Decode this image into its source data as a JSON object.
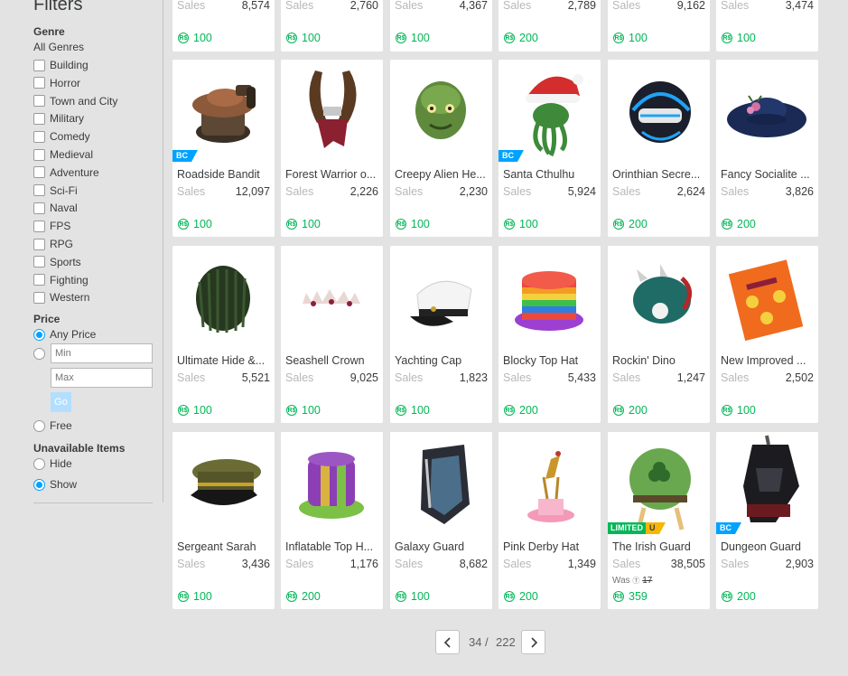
{
  "sidebar": {
    "title": "Filters",
    "genre_title": "Genre",
    "genre_all": "All Genres",
    "genres": [
      "Building",
      "Horror",
      "Town and City",
      "Military",
      "Comedy",
      "Medieval",
      "Adventure",
      "Sci-Fi",
      "Naval",
      "FPS",
      "RPG",
      "Sports",
      "Fighting",
      "Western"
    ],
    "price_title": "Price",
    "any_price": "Any Price",
    "min_placeholder": "Min",
    "max_placeholder": "Max",
    "go_label": "Go",
    "free_label": "Free",
    "unavailable_title": "Unavailable Items",
    "hide_label": "Hide",
    "show_label": "Show"
  },
  "top_row": [
    {
      "sales_label": "Sales",
      "sales": "8,574",
      "price": "100"
    },
    {
      "sales_label": "Sales",
      "sales": "2,760",
      "price": "100"
    },
    {
      "sales_label": "Sales",
      "sales": "4,367",
      "price": "100"
    },
    {
      "sales_label": "Sales",
      "sales": "2,789",
      "price": "200"
    },
    {
      "sales_label": "Sales",
      "sales": "9,162",
      "price": "100"
    },
    {
      "sales_label": "Sales",
      "sales": "3,474",
      "price": "100"
    }
  ],
  "items": [
    {
      "name": "Roadside Bandit",
      "sales_label": "Sales",
      "sales": "12,097",
      "price": "100",
      "badge": "BC",
      "icon": "roadside-bandit-hat-icon"
    },
    {
      "name": "Forest Warrior o...",
      "sales_label": "Sales",
      "sales": "2,226",
      "price": "100",
      "icon": "forest-warrior-horns-icon"
    },
    {
      "name": "Creepy Alien He...",
      "sales_label": "Sales",
      "sales": "2,230",
      "price": "100",
      "icon": "alien-head-icon"
    },
    {
      "name": "Santa Cthulhu",
      "sales_label": "Sales",
      "sales": "5,924",
      "price": "100",
      "badge": "BC",
      "icon": "santa-cthulhu-icon"
    },
    {
      "name": "Orinthian Secre...",
      "sales_label": "Sales",
      "sales": "2,624",
      "price": "200",
      "icon": "orinthian-helmet-icon"
    },
    {
      "name": "Fancy Socialite ...",
      "sales_label": "Sales",
      "sales": "3,826",
      "price": "200",
      "icon": "fancy-hat-icon"
    },
    {
      "name": "Ultimate Hide &...",
      "sales_label": "Sales",
      "sales": "5,521",
      "price": "100",
      "icon": "leafy-hair-icon"
    },
    {
      "name": "Seashell Crown",
      "sales_label": "Sales",
      "sales": "9,025",
      "price": "100",
      "icon": "seashell-crown-icon"
    },
    {
      "name": "Yachting Cap",
      "sales_label": "Sales",
      "sales": "1,823",
      "price": "100",
      "icon": "yachting-cap-icon"
    },
    {
      "name": "Blocky Top Hat",
      "sales_label": "Sales",
      "sales": "5,433",
      "price": "200",
      "icon": "rainbow-top-hat-icon"
    },
    {
      "name": "Rockin' Dino",
      "sales_label": "Sales",
      "sales": "1,247",
      "price": "200",
      "icon": "dino-helmet-icon"
    },
    {
      "name": "New Improved ...",
      "sales_label": "Sales",
      "sales": "2,502",
      "price": "100",
      "icon": "joke-book-icon"
    },
    {
      "name": "Sergeant Sarah",
      "sales_label": "Sales",
      "sales": "3,436",
      "price": "100",
      "icon": "sergeant-cap-icon"
    },
    {
      "name": "Inflatable Top H...",
      "sales_label": "Sales",
      "sales": "1,176",
      "price": "200",
      "icon": "inflatable-top-hat-icon"
    },
    {
      "name": "Galaxy Guard",
      "sales_label": "Sales",
      "sales": "8,682",
      "price": "100",
      "icon": "galaxy-guard-helmet-icon"
    },
    {
      "name": "Pink Derby Hat",
      "sales_label": "Sales",
      "sales": "1,349",
      "price": "200",
      "icon": "pink-derby-hat-icon"
    },
    {
      "name": "The Irish Guard",
      "sales_label": "Sales",
      "sales": "38,505",
      "price": "359",
      "badge": "LIMITED",
      "badge_u": "U",
      "was_label": "Was",
      "was_price": "17",
      "icon": "irish-guard-helmet-icon"
    },
    {
      "name": "Dungeon Guard",
      "sales_label": "Sales",
      "sales": "2,903",
      "price": "200",
      "badge": "BC",
      "icon": "dungeon-guard-helmet-icon"
    }
  ],
  "robux_symbol": "R$",
  "pager": {
    "current": "34",
    "separator": "/",
    "total": "222"
  },
  "colors": {
    "robux_green": "#02b757",
    "bc_blue": "#00a2ff",
    "limited_green": "#02b757",
    "unique_yellow": "#f6b702",
    "background": "#e3e3e3"
  }
}
